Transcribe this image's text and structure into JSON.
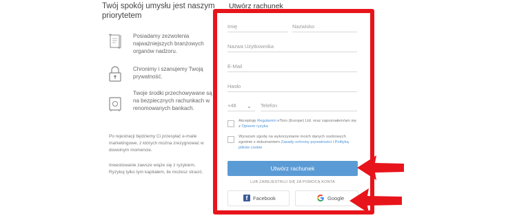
{
  "left": {
    "title": "Twój spokój umysłu jest naszym priorytetem",
    "features": [
      {
        "icon": "certificate-icon",
        "text": "Posiadamy zezwolenia najważniejszych branżowych organów nadzoru."
      },
      {
        "icon": "lock-icon",
        "text": "Chronimy i szanujemy Twoją prywatność."
      },
      {
        "icon": "safe-icon",
        "text": "Twoje środki przechowywane są na bezpiecznych rachunkach w renomowanych bankach."
      }
    ],
    "note1": "Po rejestracji będziemy Ci przesyłać e-maile marketingowe, z których można zrezygnować w dowolnym momencie.",
    "note2": "Inwestowanie zawsze wiąże się z ryzykiem. Ryzykuj tylko tym kapitałem, ile możesz stracić."
  },
  "form": {
    "title": "Utwórz rachunek",
    "first_name_placeholder": "Imię",
    "last_name_placeholder": "Nazwisko",
    "username_placeholder": "Nazwa Użytkownika",
    "email_placeholder": "E-Mail",
    "password_placeholder": "Hasło",
    "phone_code": "+48",
    "phone_placeholder": "Telefon",
    "consent1_a": "Akceptuję ",
    "consent1_link1": "Regulamin",
    "consent1_b": " eToro (Europe) Ltd. oraz zapoznałem/am się z ",
    "consent1_link2": "Opisem ryzyka",
    "consent2_a": "Wyrażam zgodę na wykorzystanie moich danych osobowych zgodnie z dokumentem ",
    "consent2_link1": "Zasady ochrony prywatności",
    "consent2_b": " i ",
    "consent2_link2": "Polityką plików cookie",
    "submit_label": "Utwórz rachunek",
    "or_label": "LUB ZAREJESTRUJ SIĘ ZA POMOCĄ KONTA",
    "facebook_label": "Facebook",
    "google_label": "Google"
  },
  "colors": {
    "frame": "#e8141b",
    "primary": "#5b9bd5",
    "facebook": "#3b5998"
  }
}
